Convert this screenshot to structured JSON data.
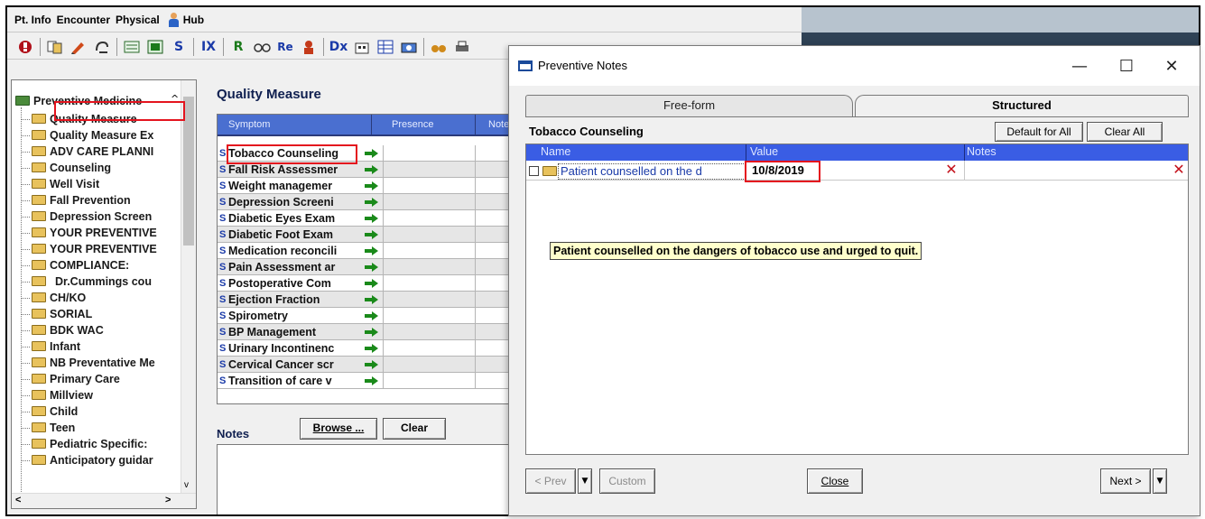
{
  "menu": {
    "items": [
      "Pt. Info",
      "Encounter",
      "Physical",
      "Hub"
    ]
  },
  "toolbar": {
    "icons": [
      "stop-icon",
      "copy-icon",
      "pencil-icon",
      "link-icon",
      "keyboard-icon",
      "template-icon",
      "s-icon",
      "ix-icon",
      "r-icon",
      "glasses-icon",
      "rx-icon",
      "person-icon",
      "dx-icon",
      "building-icon",
      "grid-icon",
      "camera-icon",
      "binoculars-icon",
      "print-icon"
    ],
    "s_label": "S",
    "ix_label": "IX",
    "r_label": "R",
    "rx_label": "Re",
    "dx_label": "Dx"
  },
  "tree": {
    "root": "Preventive Medicine",
    "items": [
      "Quality Measure",
      "Quality Measure Ex",
      "ADV CARE PLANNI",
      "Counseling",
      "Well Visit",
      "Fall Prevention",
      "Depression Screen",
      "YOUR PREVENTIVE",
      "YOUR PREVENTIVE",
      "COMPLIANCE:",
      "Dr.Cummings cou",
      "CH/KO",
      "SORIAL",
      "BDK WAC",
      "Infant",
      "NB Preventative Me",
      "Primary Care",
      "Millview",
      "Child",
      "Teen",
      "Pediatric Specific:",
      "Anticipatory guidar"
    ],
    "selected_index": 0
  },
  "quality_measure": {
    "title": "Quality Measure",
    "columns": [
      "Symptom",
      "Presence",
      "Notes"
    ],
    "badge": "S",
    "rows": [
      "Tobacco Counseling",
      "Fall Risk Assessmer",
      "Weight managemer",
      "Depression Screeni",
      "Diabetic Eyes Exam",
      "Diabetic Foot Exam",
      "Medication reconcili",
      "Pain Assessment ar",
      "Postoperative Com",
      "Ejection Fraction",
      "Spirometry",
      "BP Management",
      "Urinary Incontinenc",
      "Cervical Cancer scr",
      "Transition of care v"
    ]
  },
  "notes": {
    "label": "Notes",
    "browse_label": "Browse ...",
    "clear_label": "Clear"
  },
  "dialog": {
    "title": "Preventive Notes",
    "minimize": "—",
    "maximize": "☐",
    "close": "✕",
    "tabs": [
      "Free-form",
      "Structured"
    ],
    "active_tab": "Structured",
    "section_title": "Tobacco Counseling",
    "default_for_all_label": "Default for All",
    "clear_all_label": "Clear All",
    "grid_columns": [
      "Name",
      "Value",
      "Notes"
    ],
    "row": {
      "name": "Patient counselled on the d",
      "value": "10/8/2019",
      "notes": ""
    },
    "tooltip": "Patient counselled on the dangers of tobacco use and urged to quit.",
    "buttons": {
      "prev": "< Prev",
      "custom": "Custom",
      "close": "Close",
      "next": "Next >"
    }
  },
  "colors": {
    "highlight_box": "#e4141e",
    "grid_header": "#3a5de4",
    "tooltip_bg": "#ffffcc"
  }
}
